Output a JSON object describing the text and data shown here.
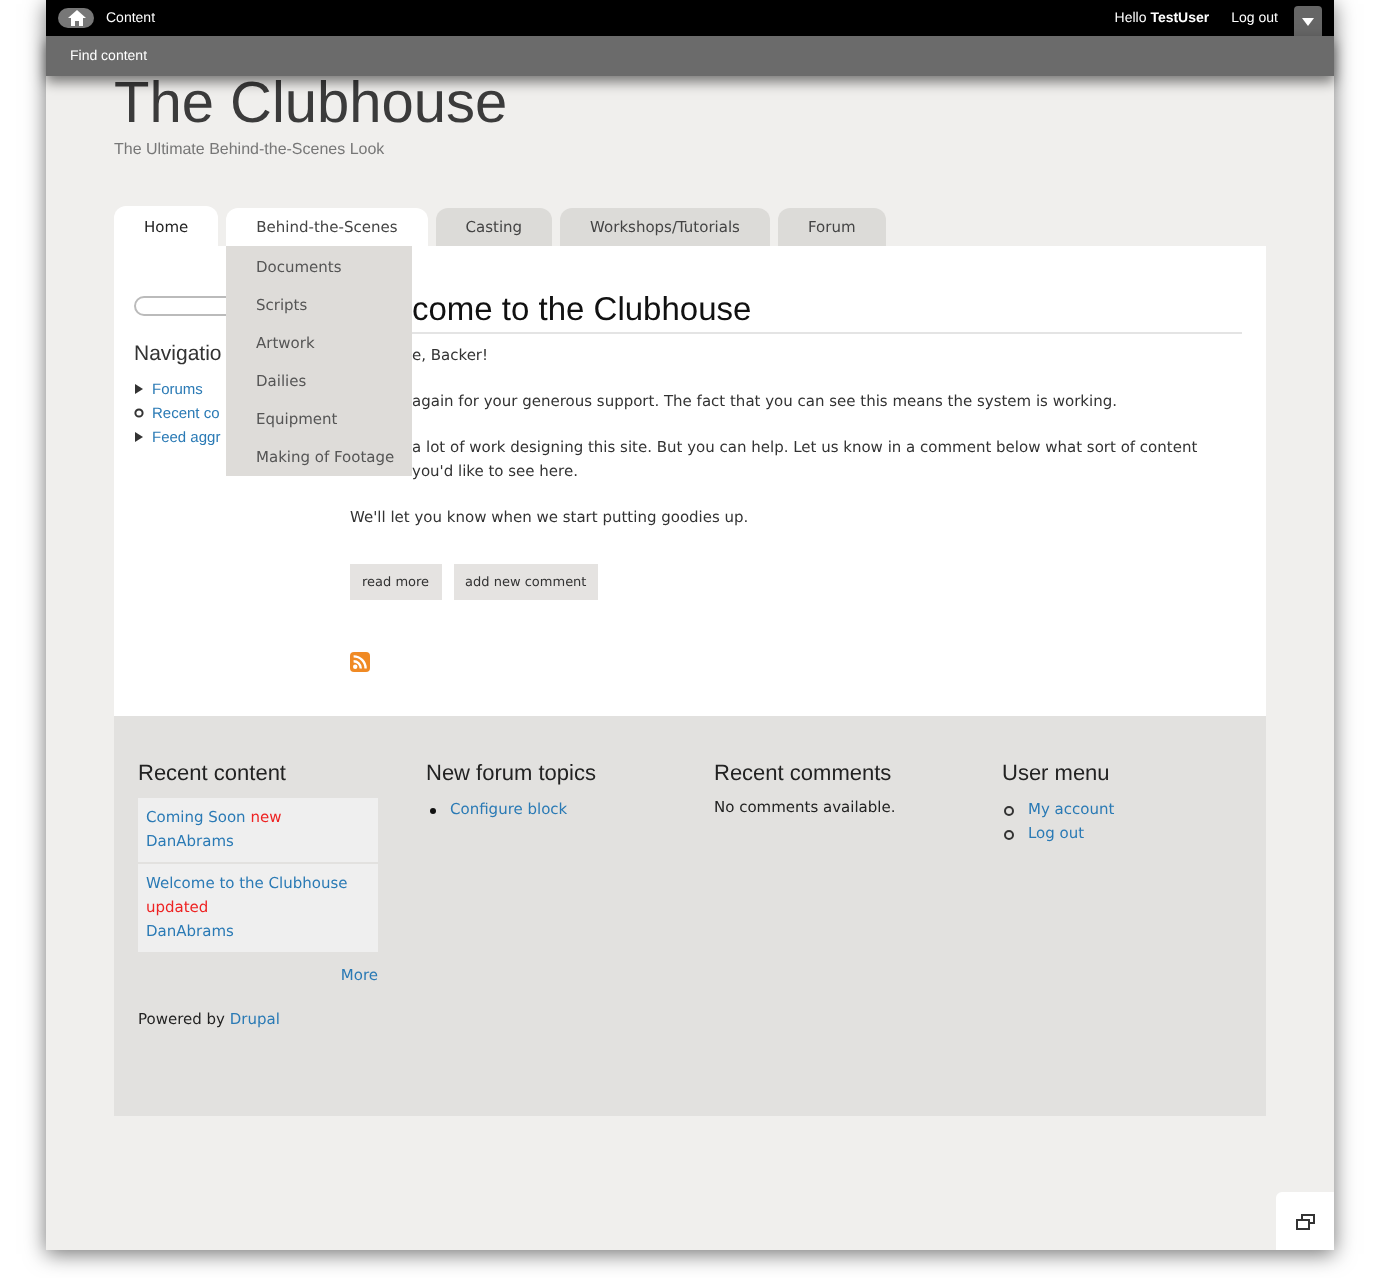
{
  "toolbar": {
    "items": [
      "Content"
    ],
    "greeting": "Hello",
    "user": "TestUser",
    "logout": "Log out"
  },
  "shortcuts": [
    "Find content"
  ],
  "site": {
    "name": "The Clubhouse",
    "slogan": "The Ultimate Behind-the-Scenes Look"
  },
  "tabs": [
    {
      "label": "Home",
      "selected": true,
      "expanded": false
    },
    {
      "label": "Behind-the-Scenes",
      "selected": false,
      "expanded": true
    },
    {
      "label": "Casting",
      "selected": false,
      "expanded": false
    },
    {
      "label": "Workshops/Tutorials",
      "selected": false,
      "expanded": false
    },
    {
      "label": "Forum",
      "selected": false,
      "expanded": false
    }
  ],
  "dropdown": [
    "Documents",
    "Scripts",
    "Artwork",
    "Dailies",
    "Equipment",
    "Making of Footage"
  ],
  "sidebar": {
    "title": "Navigatio",
    "items": [
      {
        "label": "Forums",
        "kind": "collapsed"
      },
      {
        "label": "Recent co",
        "kind": "leaf"
      },
      {
        "label": "Feed aggr",
        "kind": "collapsed"
      }
    ]
  },
  "article": {
    "title": "come to the Clubhouse",
    "paragraphs": [
      [
        "e, Backer!"
      ],
      [
        "again for your generous support. The fact that you can see this means the system is working."
      ],
      [
        "a lot of work designing this site. But you can help. Let us know in a comment below what sort of content",
        "you'd like to see here."
      ],
      [
        "We'll let you know when we start putting goodies up."
      ]
    ],
    "links": [
      "read more",
      "add new comment"
    ]
  },
  "footer": {
    "recent_content": {
      "title": "Recent content",
      "items": [
        {
          "title": "Coming Soon",
          "marker": "new",
          "author": "DanAbrams"
        },
        {
          "title": "Welcome to the Clubhouse",
          "marker": "updated",
          "author": "DanAbrams"
        }
      ],
      "more": "More"
    },
    "forum": {
      "title": "New forum topics",
      "items": [
        "Configure block"
      ]
    },
    "comments": {
      "title": "Recent comments",
      "empty": "No comments available."
    },
    "user_menu": {
      "title": "User menu",
      "items": [
        "My account",
        "Log out"
      ]
    },
    "powered": "Powered by",
    "powered_link": "Drupal"
  }
}
